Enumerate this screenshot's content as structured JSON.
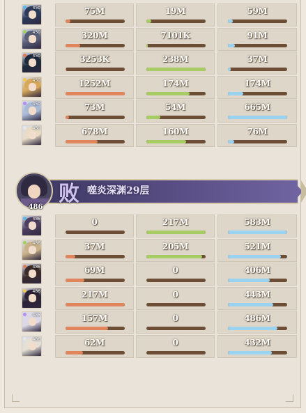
{
  "colors": {
    "damage": "#e0855c",
    "taken": "#a6cc63",
    "healing": "#9bd2ef",
    "banner": "#4f4679"
  },
  "team_top": [
    {
      "level": "450",
      "portrait_icon": "hero-portrait-icon",
      "c1": {
        "text": "75M",
        "fill": 0.08
      },
      "c2": {
        "text": "19M",
        "fill": 0.08
      },
      "c3": {
        "text": "59M",
        "fill": 0.08
      }
    },
    {
      "level": "450",
      "portrait_icon": "hero-portrait-icon",
      "c1": {
        "text": "320M",
        "fill": 0.25
      },
      "c2": {
        "text": "7101K",
        "fill": 0.02
      },
      "c3": {
        "text": "91M",
        "fill": 0.12
      }
    },
    {
      "level": "450",
      "portrait_icon": "hero-portrait-icon",
      "c1": {
        "text": "3253K",
        "fill": 0.01
      },
      "c2": {
        "text": "238M",
        "fill": 1.0
      },
      "c3": {
        "text": "37M",
        "fill": 0.05
      }
    },
    {
      "level": "450",
      "portrait_icon": "hero-portrait-icon",
      "c1": {
        "text": "1252M",
        "fill": 1.0
      },
      "c2": {
        "text": "174M",
        "fill": 0.73
      },
      "c3": {
        "text": "174M",
        "fill": 0.26
      }
    },
    {
      "level": "450",
      "portrait_icon": "hero-portrait-icon",
      "c1": {
        "text": "73M",
        "fill": 0.06
      },
      "c2": {
        "text": "54M",
        "fill": 0.23
      },
      "c3": {
        "text": "665M",
        "fill": 1.0
      }
    },
    {
      "level": "450",
      "portrait_icon": "hero-portrait-icon",
      "c1": {
        "text": "678M",
        "fill": 0.54
      },
      "c2": {
        "text": "160M",
        "fill": 0.67
      },
      "c3": {
        "text": "76M",
        "fill": 0.11
      }
    }
  ],
  "banner": {
    "result": "败",
    "stage": "噬炎深渊29层",
    "player_level": "486",
    "avatar_icon": "enemy-leader-avatar-icon"
  },
  "team_bottom": [
    {
      "level": "486",
      "portrait_icon": "enemy-portrait-icon",
      "c1": {
        "text": "0",
        "fill": 0.0
      },
      "c2": {
        "text": "217M",
        "fill": 1.0
      },
      "c3": {
        "text": "583M",
        "fill": 1.0
      }
    },
    {
      "level": "486",
      "portrait_icon": "enemy-portrait-icon",
      "c1": {
        "text": "37M",
        "fill": 0.17
      },
      "c2": {
        "text": "205M",
        "fill": 0.94
      },
      "c3": {
        "text": "521M",
        "fill": 0.89
      }
    },
    {
      "level": "486",
      "portrait_icon": "enemy-portrait-icon",
      "c1": {
        "text": "69M",
        "fill": 0.32
      },
      "c2": {
        "text": "0",
        "fill": 0.0
      },
      "c3": {
        "text": "406M",
        "fill": 0.7
      }
    },
    {
      "level": "486",
      "portrait_icon": "enemy-portrait-icon",
      "c1": {
        "text": "217M",
        "fill": 1.0
      },
      "c2": {
        "text": "0",
        "fill": 0.0
      },
      "c3": {
        "text": "443M",
        "fill": 0.76
      }
    },
    {
      "level": "486",
      "portrait_icon": "enemy-portrait-icon",
      "c1": {
        "text": "157M",
        "fill": 0.72
      },
      "c2": {
        "text": "0",
        "fill": 0.0
      },
      "c3": {
        "text": "486M",
        "fill": 0.83
      }
    },
    {
      "level": "486",
      "portrait_icon": "enemy-portrait-icon",
      "c1": {
        "text": "62M",
        "fill": 0.29
      },
      "c2": {
        "text": "0",
        "fill": 0.0
      },
      "c3": {
        "text": "432M",
        "fill": 0.74
      }
    }
  ]
}
